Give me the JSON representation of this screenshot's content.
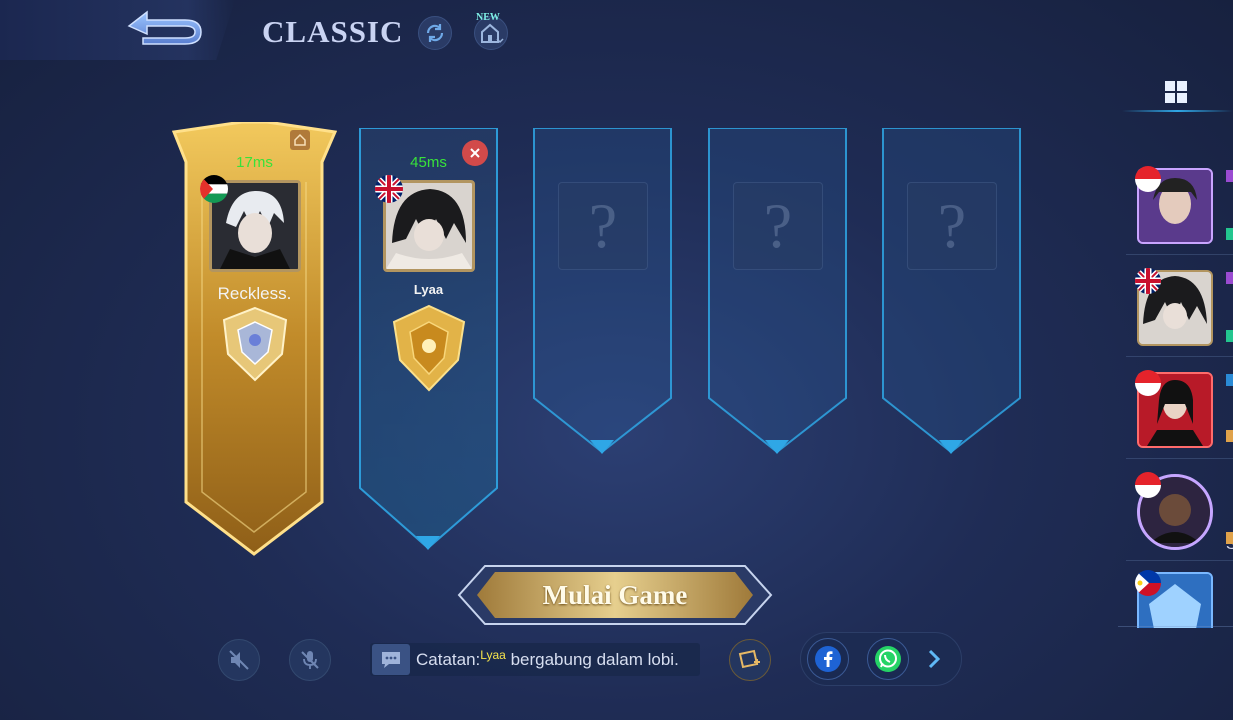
{
  "header": {
    "mode_title": "CLASSIC",
    "new_badge": "NEW"
  },
  "slots": [
    {
      "type": "player",
      "ping": "17ms",
      "name": "Reckless.",
      "flag": "palestine",
      "host": true
    },
    {
      "type": "player",
      "ping": "45ms",
      "name": "Lyaa",
      "flag": "uk",
      "removable": true
    },
    {
      "type": "empty",
      "placeholder": "?"
    },
    {
      "type": "empty",
      "placeholder": "?"
    },
    {
      "type": "empty",
      "placeholder": "?"
    }
  ],
  "start_button": {
    "label": "Mulai Game"
  },
  "chat": {
    "prefix": "Catatan:",
    "name": "Lyaa",
    "message": "bergabung dalam lobi."
  },
  "friends_panel": {
    "partial_letter": "S",
    "friends": [
      {
        "flag": "indonesia"
      },
      {
        "flag": "uk"
      },
      {
        "flag": "indonesia"
      },
      {
        "flag": "indonesia"
      },
      {
        "flag": "philippines"
      }
    ]
  },
  "share": {
    "items": [
      "facebook-icon",
      "whatsapp-icon",
      "chevron-right-icon"
    ]
  },
  "colors": {
    "ping": "#38e23a",
    "gold": "#d9a93c",
    "accent_blue": "#2fa7e6",
    "chat_name": "#f6e44c"
  }
}
